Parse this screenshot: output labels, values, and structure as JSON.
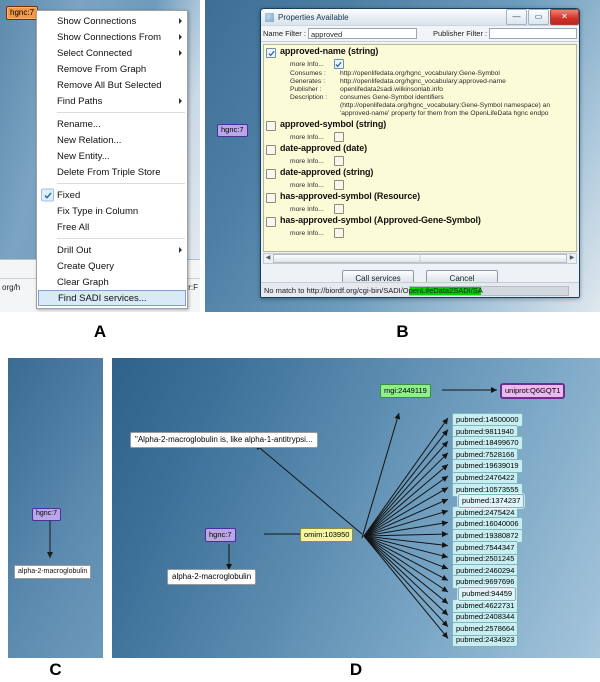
{
  "figure": {
    "panel_letters": [
      "A",
      "B",
      "C",
      "D"
    ]
  },
  "panelA": {
    "node_label": "hgnc:7",
    "url_left": "org/h",
    "url_right": "r:F",
    "menu": {
      "items": [
        {
          "label": "Show Connections",
          "submenu": true,
          "checked": false,
          "selected": false
        },
        {
          "label": "Show Connections From",
          "submenu": true,
          "checked": false,
          "selected": false
        },
        {
          "label": "Select Connected",
          "submenu": true,
          "checked": false,
          "selected": false
        },
        {
          "label": "Remove From Graph",
          "submenu": false,
          "checked": false,
          "selected": false
        },
        {
          "label": "Remove All But Selected",
          "submenu": false,
          "checked": false,
          "selected": false
        },
        {
          "label": "Find Paths",
          "submenu": true,
          "checked": false,
          "selected": false
        },
        {
          "separator": true
        },
        {
          "label": "Rename...",
          "submenu": false,
          "checked": false,
          "selected": false
        },
        {
          "label": "New Relation...",
          "submenu": false,
          "checked": false,
          "selected": false
        },
        {
          "label": "New Entity...",
          "submenu": false,
          "checked": false,
          "selected": false
        },
        {
          "label": "Delete From Triple Store",
          "submenu": false,
          "checked": false,
          "selected": false
        },
        {
          "separator": true
        },
        {
          "label": "Fixed",
          "submenu": false,
          "checked": true,
          "selected": false
        },
        {
          "label": "Fix Type in Column",
          "submenu": false,
          "checked": false,
          "selected": false
        },
        {
          "label": "Free All",
          "submenu": false,
          "checked": false,
          "selected": false
        },
        {
          "separator": true
        },
        {
          "label": "Drill Out",
          "submenu": true,
          "checked": false,
          "selected": false
        },
        {
          "label": "Create Query",
          "submenu": false,
          "checked": false,
          "selected": false
        },
        {
          "label": "Clear Graph",
          "submenu": false,
          "checked": false,
          "selected": false
        },
        {
          "label": "Find SADI services...",
          "submenu": false,
          "checked": false,
          "selected": true
        }
      ]
    }
  },
  "panelB": {
    "node_label": "hgnc:7",
    "window": {
      "title": "Properties Available",
      "buttons": {
        "minimize": "—",
        "maximize": "▭",
        "close": "✕"
      },
      "filters": {
        "name_label": "Name Filter :",
        "name_value": "approved",
        "publisher_label": "Publisher Filter :",
        "publisher_value": ""
      },
      "properties": [
        {
          "name": "approved-name (string)",
          "checked": true,
          "more_info_label": "more Info...",
          "more_info_checked": true,
          "rows": [
            {
              "key": "Consumes :",
              "value": "http://openlifedata.org/hgnc_vocabulary:Gene-Symbol"
            },
            {
              "key": "Generates :",
              "value": "http://openlifedata.org/hgnc_vocabulary:approved-name"
            },
            {
              "key": "Publisher :",
              "value": "openlifedata2sadi.wilkinsonlab.info"
            },
            {
              "key": "Description :",
              "value": "consumes Gene-Symbol identifiers"
            },
            {
              "key": "",
              "value": "(http://openlifedata.org/hgnc_vocabulary:Gene-Symbol namespace) an"
            },
            {
              "key": "",
              "value": "'approved-name' property for them from the OpenLifeData hgnc endpo"
            }
          ]
        },
        {
          "name": "approved-symbol (string)",
          "checked": false,
          "more_info_label": "more Info...",
          "more_info_checked": false,
          "rows": []
        },
        {
          "name": "date-approved (date)",
          "checked": false,
          "more_info_label": "more Info...",
          "more_info_checked": false,
          "rows": []
        },
        {
          "name": "date-approved (string)",
          "checked": false,
          "more_info_label": "more Info...",
          "more_info_checked": false,
          "rows": []
        },
        {
          "name": "has-approved-symbol (Resource)",
          "checked": false,
          "more_info_label": "more Info...",
          "more_info_checked": false,
          "rows": []
        },
        {
          "name": "has-approved-symbol (Approved-Gene-Symbol)",
          "checked": false,
          "more_info_label": "more Info...",
          "more_info_checked": false,
          "rows": []
        }
      ],
      "buttons_row": {
        "call": "Call services",
        "cancel": "Cancel"
      },
      "status": "No match to http://biordf.org/cgi-bin/SADI/OpenLifeData2SADI/SA",
      "progress_color": "#00cc00"
    }
  },
  "panelC": {
    "nodes": [
      {
        "id": "hgnc",
        "label": "hgnc:7"
      },
      {
        "id": "a2m",
        "label": "alpha-2-macroglobulin"
      }
    ]
  },
  "panelD": {
    "nodes": [
      {
        "id": "mgi",
        "label": "mgi:2449119"
      },
      {
        "id": "uniprot",
        "label": "uniprot:Q6GQT1"
      },
      {
        "id": "quote",
        "label": "\"Alpha-2-macroglobulin is, like alpha-1-antitrypsi..."
      },
      {
        "id": "hgnc",
        "label": "hgnc:7"
      },
      {
        "id": "omim",
        "label": "omim:103950"
      },
      {
        "id": "a2m",
        "label": "alpha-2-macroglobulin"
      }
    ],
    "pubmed_nodes": [
      {
        "label": "pubmed:14500000",
        "occluded": true
      },
      {
        "label": "pubmed:9811940",
        "occluded": false
      },
      {
        "label": "pubmed:18499670",
        "occluded": false
      },
      {
        "label": "pubmed:7528166",
        "occluded": false
      },
      {
        "label": "pubmed:19639019",
        "occluded": false
      },
      {
        "label": "pubmed:2476422",
        "occluded": true
      },
      {
        "label": "pubmed:10573555",
        "occluded": true
      },
      {
        "label": "pubmed:1374237",
        "occluded": false,
        "highlight": true
      },
      {
        "label": "pubmed:2475424",
        "occluded": true
      },
      {
        "label": "pubmed:16040006",
        "occluded": true
      },
      {
        "label": "pubmed:19380872",
        "occluded": false
      },
      {
        "label": "pubmed:7544347",
        "occluded": false
      },
      {
        "label": "pubmed:2501245",
        "occluded": true
      },
      {
        "label": "pubmed:2460294",
        "occluded": true
      },
      {
        "label": "pubmed:9697696",
        "occluded": true
      },
      {
        "label": "pubmed:94459",
        "occluded": false,
        "highlight": true
      },
      {
        "label": "pubmed:4622731",
        "occluded": false
      },
      {
        "label": "pubmed:2408344",
        "occluded": true
      },
      {
        "label": "pubmed:2578664",
        "occluded": false
      },
      {
        "label": "pubmed:2434923",
        "occluded": true
      }
    ]
  }
}
